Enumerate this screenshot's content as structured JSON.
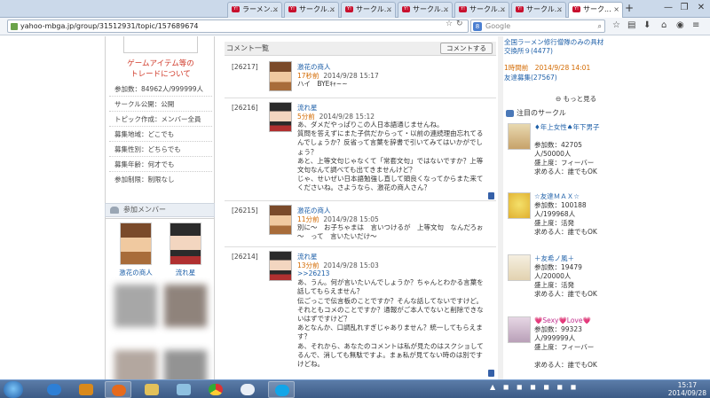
{
  "browser": {
    "tabs": [
      {
        "label": "ラーメン..."
      },
      {
        "label": "サークル..."
      },
      {
        "label": "サークル..."
      },
      {
        "label": "サークル..."
      },
      {
        "label": "サークル..."
      },
      {
        "label": "サークル..."
      },
      {
        "label": "サーク..."
      }
    ],
    "new_tab": "+",
    "url": "yahoo-mbga.jp/group/31512931/topic/157689674",
    "search_placeholder": "Google",
    "window_minimize": "—",
    "window_maximize": "❐",
    "window_close": "✕"
  },
  "left_sidebar": {
    "game_item_link": "ゲームアイテム等の\nトレードについて",
    "info_rows": [
      "参加数：84962人/999999人",
      "サークル公開：公開",
      "トピック作成：メンバー全員",
      "募集地域：どこでも",
      "募集性別：どちらでも",
      "募集年齢：何才でも",
      "参加制限：制限なし"
    ],
    "members_header": "参加メンバー",
    "members": [
      {
        "name": "激花の商人"
      },
      {
        "name": "流れ星"
      }
    ]
  },
  "comments": {
    "header": "コメント一覧",
    "post_button": "コメントする",
    "items": [
      {
        "num": "[26217]",
        "name": "激花の商人",
        "ago": "17秒前",
        "date": "2014/9/28 15:17",
        "body": "ハイ　BYEｷｬ~~"
      },
      {
        "num": "[26216]",
        "name": "流れ星",
        "ago": "5分前",
        "date": "2014/9/28 15:12",
        "body": "あ、ダメだやっぱりこの人日本語通じませんね。\n質問を答えずにまた子供だからって・以前の連続理由忘れてるんでしょうか？反省って言葉を辞書で引いてみてはいかがでしょう？\nあと、上等文句じゃなくて「常套文句」ではないですか？上等文句なんて調べても出てきませんけど？\nじゃ、せいぜい日本語勉強し直して頭良くなってからまた来てくださいね。さようなら、激花の商人さん？"
      },
      {
        "num": "[26215]",
        "name": "激花の商人",
        "ago": "11分前",
        "date": "2014/9/28 15:05",
        "body": "別に～　お子ちゃまは　言いつけるが　上等文句　なんだろぉ～　って　言いたいだけ～"
      },
      {
        "num": "[26214]",
        "name": "流れ星",
        "ago": "13分前",
        "date": "2014/9/28 15:03",
        "reply": ">>26213",
        "body": "あ、うん。何が言いたいんでしょうか？ちゃんとわかる言葉を話してもらえません？\n伝ごっこで伝言板のことですか？そんな話してないですけど。\nそれともコメのことですか？通報がご本人でないと削除できないはずですけど？\nあとなんか、口調乱れすぎじゃありません？統一してもらえます？\nあ、それから、あなたのコメントは私が見たのはスクショしてるんで、消しても無駄ですよ。まぁ私が見てない時のは別ですけどね。"
      }
    ]
  },
  "right_sidebar": {
    "top_lines": [
      "全国ラーメン修行僧隊のみの具材交換所９(4477)",
      "1時間前　2014/9/28 14:01",
      "友達募集(27567)"
    ],
    "more_link": "もっと見る",
    "section_header": "注目のサークル",
    "circles": [
      {
        "title": "♦年上女性♠年下男子",
        "lines": [
          "参加数：42705人/50000人",
          "盛上度：フィーバー",
          "求める人：誰でもOK"
        ]
      },
      {
        "title": "☆友達ＭＡＸ☆",
        "lines": [
          "参加数：100188人/199968人",
          "盛上度：活発",
          "求める人：誰でもOK"
        ]
      },
      {
        "title": "＋友希ノ風＋",
        "lines": [
          "参加数：19479人/20000人",
          "盛上度：活発",
          "求める人：誰でもOK"
        ]
      },
      {
        "title": "💗Sexy💗Love💗",
        "lines": [
          "参加数：99323人/999999人",
          "盛上度：フィーバー",
          "求める人：誰でもOK"
        ]
      }
    ]
  },
  "taskbar": {
    "time": "15:17",
    "date": "2014/09/28"
  },
  "colors": {
    "link_blue": "#1d5fa8",
    "orange_time": "#d36a00",
    "red_link": "#d03a2a"
  }
}
